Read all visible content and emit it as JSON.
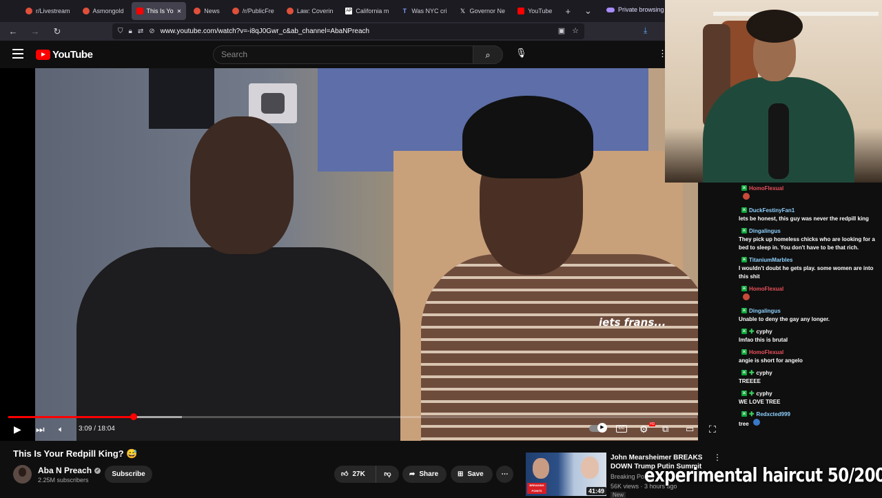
{
  "browser": {
    "tabs": [
      {
        "label": "r/Livestream",
        "icon": "reddit-icon"
      },
      {
        "label": "Asmongold",
        "icon": "reddit-icon"
      },
      {
        "label": "This Is Yo",
        "icon": "youtube-icon",
        "active": true
      },
      {
        "label": "News",
        "icon": "reddit-icon"
      },
      {
        "label": "/r/PublicFre",
        "icon": "reddit-icon"
      },
      {
        "label": "Law: Coverin",
        "icon": "reddit-icon"
      },
      {
        "label": "California m",
        "icon": "ap-icon"
      },
      {
        "label": "Was NYC cri",
        "icon": "tribune-icon"
      },
      {
        "label": "Governor Ne",
        "icon": "x-icon"
      },
      {
        "label": "YouTube",
        "icon": "youtube-icon"
      }
    ],
    "private_label": "Private browsing",
    "url": "www.youtube.com/watch?v=-i8qJ0Gwr_c&ab_channel=AbaNPreach"
  },
  "youtube": {
    "logo_text": "YouTube",
    "search_placeholder": "Search"
  },
  "player": {
    "time_display": "3:09 / 18:04",
    "played_fraction": 0.182,
    "buffered_fraction": 0.252,
    "shirt_text": "iets frans...",
    "hd_badge": "HD",
    "cc_label": "CC"
  },
  "video": {
    "title": "This Is Your Redpill King? 😅",
    "channel": "Aba N Preach",
    "subscribers": "2.25M subscribers",
    "subscribe_label": "Subscribe",
    "likes": "27K",
    "share_label": "Share",
    "save_label": "Save"
  },
  "recommended": {
    "title": "John Mearsheimer BREAKS DOWN Trump Putin Summit",
    "channel": "Breaking Points",
    "meta": "56K views · 3 hours ago",
    "duration": "41:49",
    "badge": "New",
    "thumb_badge": "BREAKING POINTS"
  },
  "chat": [
    {
      "user": "HomoFlexual",
      "user_color": "#e8505b",
      "badge": "mod",
      "text": "",
      "emote": "red"
    },
    {
      "user": "DuckFestinyFan1",
      "user_color": "#8ed1ff",
      "badge": "mod",
      "text": "lets be honest, this guy was never the redpill king"
    },
    {
      "user": "Dingalingus",
      "user_color": "#8ed1ff",
      "badge": "mod",
      "text": "They pick up homeless chicks who are looking for a bed to sleep in. You don't have to be that rich."
    },
    {
      "user": "TitaniumMarbles",
      "user_color": "#8ed1ff",
      "badge": "mod",
      "text": "I wouldn't doubt he gets play. some women are into this shit"
    },
    {
      "user": "HomoFlexual",
      "user_color": "#e8505b",
      "badge": "mod",
      "text": "",
      "emote": "red"
    },
    {
      "user": "Dingalingus",
      "user_color": "#8ed1ff",
      "badge": "mod",
      "text": "Unable to deny the gay any longer."
    },
    {
      "user": "cyphy",
      "user_color": "#ffffff",
      "badge": "mod-plus",
      "text": "lmfao this is brutal"
    },
    {
      "user": "HomoFlexual",
      "user_color": "#e8505b",
      "badge": "mod",
      "text": "angie is short for angelo"
    },
    {
      "user": "cyphy",
      "user_color": "#ffffff",
      "badge": "mod-plus",
      "text": "TREEEE"
    },
    {
      "user": "cyphy",
      "user_color": "#ffffff",
      "badge": "mod-plus",
      "text": "WE LOVE TREE"
    },
    {
      "user": "Redxcted999",
      "user_color": "#8ed1ff",
      "badge": "mod-plus",
      "text": "tree",
      "emote": "blue"
    }
  ],
  "overlay_text": "experimental haircut 50/200"
}
